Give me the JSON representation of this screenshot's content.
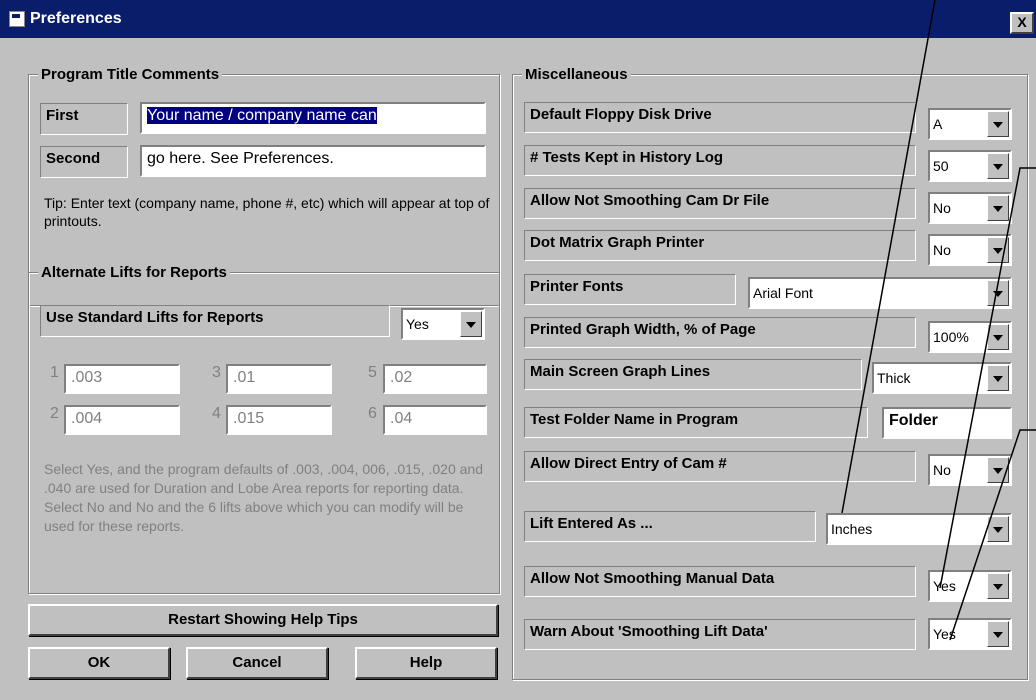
{
  "window": {
    "title": "Preferences",
    "close_label": "X"
  },
  "title_comments": {
    "heading": "Program Title Comments",
    "first_label": "First",
    "first_value": "Your name / company name can",
    "second_label": "Second",
    "second_value": "go here.  See Preferences.",
    "tip": "Tip:  Enter text (company name, phone #, etc) which will appear at top of printouts."
  },
  "alt_lifts": {
    "heading": "Alternate Lifts for Reports",
    "use_label": "Use Standard Lifts for Reports",
    "use_value": "Yes",
    "lifts": [
      {
        "num": "1",
        "value": ".003"
      },
      {
        "num": "2",
        "value": ".004"
      },
      {
        "num": "3",
        "value": ".01"
      },
      {
        "num": "4",
        "value": ".015"
      },
      {
        "num": "5",
        "value": ".02"
      },
      {
        "num": "6",
        "value": ".04"
      }
    ],
    "help_text": "Select Yes, and the program defaults of .003, .004, 006, .015, .020 and .040 are used for Duration and Lobe Area reports for reporting data.  Select No and No and the 6 lifts above which you can modify will be used for these reports."
  },
  "buttons": {
    "restart": "Restart Showing Help Tips",
    "ok": "OK",
    "cancel": "Cancel",
    "help": "Help"
  },
  "misc": {
    "heading": "Miscellaneous",
    "floppy": {
      "label": "Default Floppy Disk Drive",
      "value": "A"
    },
    "tests": {
      "label": "# Tests Kept in History Log",
      "value": "50"
    },
    "smooth_cam": {
      "label": "Allow Not Smoothing Cam Dr File",
      "value": "No"
    },
    "dot_matrix": {
      "label": "Dot Matrix Graph Printer",
      "value": "No"
    },
    "fonts": {
      "label": "Printer Fonts",
      "value": "Arial Font"
    },
    "width": {
      "label": "Printed Graph Width, % of Page",
      "value": "100%"
    },
    "lines": {
      "label": "Main Screen Graph Lines",
      "value": "Thick"
    },
    "folder": {
      "label": "Test Folder Name in Program",
      "value": "Folder"
    },
    "direct": {
      "label": "Allow Direct Entry of Cam #",
      "value": "No"
    },
    "lift_as": {
      "label": "Lift Entered As ...",
      "value": "Inches"
    },
    "smooth_manual": {
      "label": "Allow Not Smoothing Manual Data",
      "value": "Yes"
    },
    "warn": {
      "label": "Warn About 'Smoothing Lift Data'",
      "value": "Yes"
    }
  }
}
